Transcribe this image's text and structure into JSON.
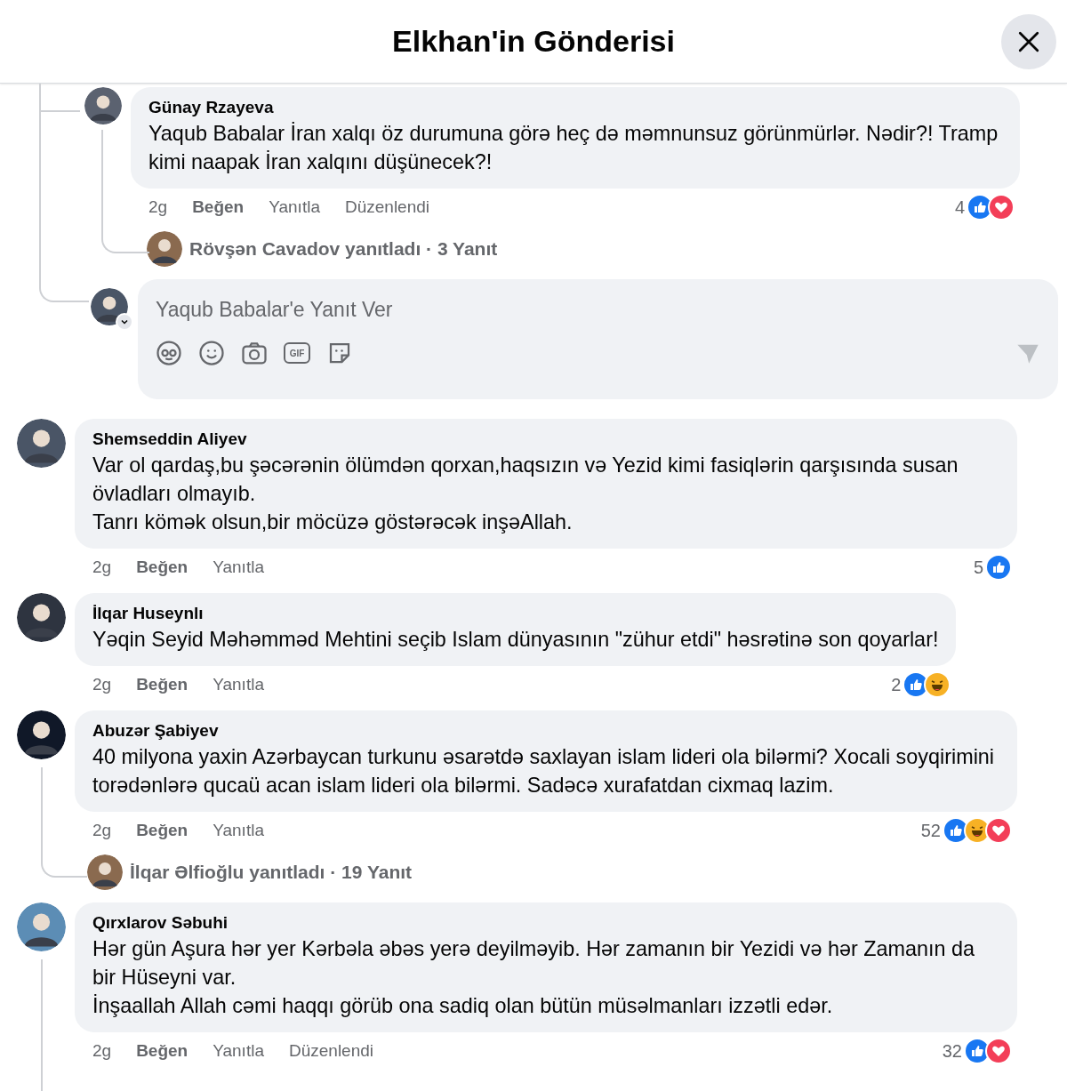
{
  "header": {
    "title": "Elkhan'in Gönderisi"
  },
  "open_thread": {
    "comments": [
      {
        "author": "Günay Rzayeva",
        "text": "Yaqub Babalar İran xalqı öz durumuna görə heç də məmnunsuz görünmürlər. Nədir?! Tramp kimi naapak İran xalqını düşünecek?!",
        "time": "2g",
        "like_label": "Beğen",
        "reply_label": "Yanıtla",
        "edited_label": "Düzenlendi",
        "reaction_count": "4",
        "reactions": [
          {
            "kind": "like"
          },
          {
            "kind": "love"
          }
        ],
        "replies_summary": "Rövşən Cavadov yanıtladı · 3 Yanıt"
      }
    ],
    "reply_box": {
      "placeholder": "Yaqub Babalar'e Yanıt Ver",
      "tools": [
        {
          "kind": "avatar"
        },
        {
          "kind": "emoji"
        },
        {
          "kind": "camera"
        },
        {
          "kind": "gif",
          "label": "GIF"
        },
        {
          "kind": "sticker"
        }
      ],
      "send_disabled": true
    }
  },
  "comments": [
    {
      "author": "Shemseddin Aliyev",
      "text": "Var ol qardaş,bu şəcərənin ölümdən qorxan,haqsızın və Yezid kimi fasiqlərin qarşısında susan övladları olmayıb.\nTanrı kömək olsun,bir möcüzə göstərəcək inşəAllah.",
      "time": "2g",
      "like_label": "Beğen",
      "reply_label": "Yanıtla",
      "reaction_count": "5",
      "reactions": [
        {
          "kind": "like"
        }
      ]
    },
    {
      "author": "İlqar Huseynlı",
      "text": "Yəqin Seyid Məhəmməd Mehtini seçib Islam dünyasının \"zühur etdi\" həsrətinə son qoyarlar!",
      "time": "2g",
      "like_label": "Beğen",
      "reply_label": "Yanıtla",
      "reaction_count": "2",
      "reactions": [
        {
          "kind": "like"
        },
        {
          "kind": "haha"
        }
      ]
    },
    {
      "author": "Abuzər Şabiyev",
      "text": "40 milyona yaxin Azərbaycan turkunu əsarətdə saxlayan islam lideri ola bilərmi? Xocali soyqirimini torədənlərə qucaü acan islam lideri ola bilərmi. Sadəcə xurafatdan cixmaq lazim.",
      "time": "2g",
      "like_label": "Beğen",
      "reply_label": "Yanıtla",
      "reaction_count": "52",
      "reactions": [
        {
          "kind": "like"
        },
        {
          "kind": "haha"
        },
        {
          "kind": "love"
        }
      ],
      "replies_summary": "İlqar Əlfioğlu yanıtladı · 19 Yanıt"
    },
    {
      "author": "Qırxlarov Səbuhi",
      "text": "Hər gün Aşura hər yer Kərbəla əbəs yerə deyilməyib. Hər zamanın bir Yezidi və hər Zamanın da bir Hüseyni var.\nİnşaallah Allah cəmi haqqı görüb ona sadiq olan bütün müsəlmanları izzətli edər.",
      "time": "2g",
      "like_label": "Beğen",
      "reply_label": "Yanıtla",
      "edited_label": "Düzenlendi",
      "reaction_count": "32",
      "reactions": [
        {
          "kind": "like"
        },
        {
          "kind": "love"
        }
      ]
    }
  ]
}
